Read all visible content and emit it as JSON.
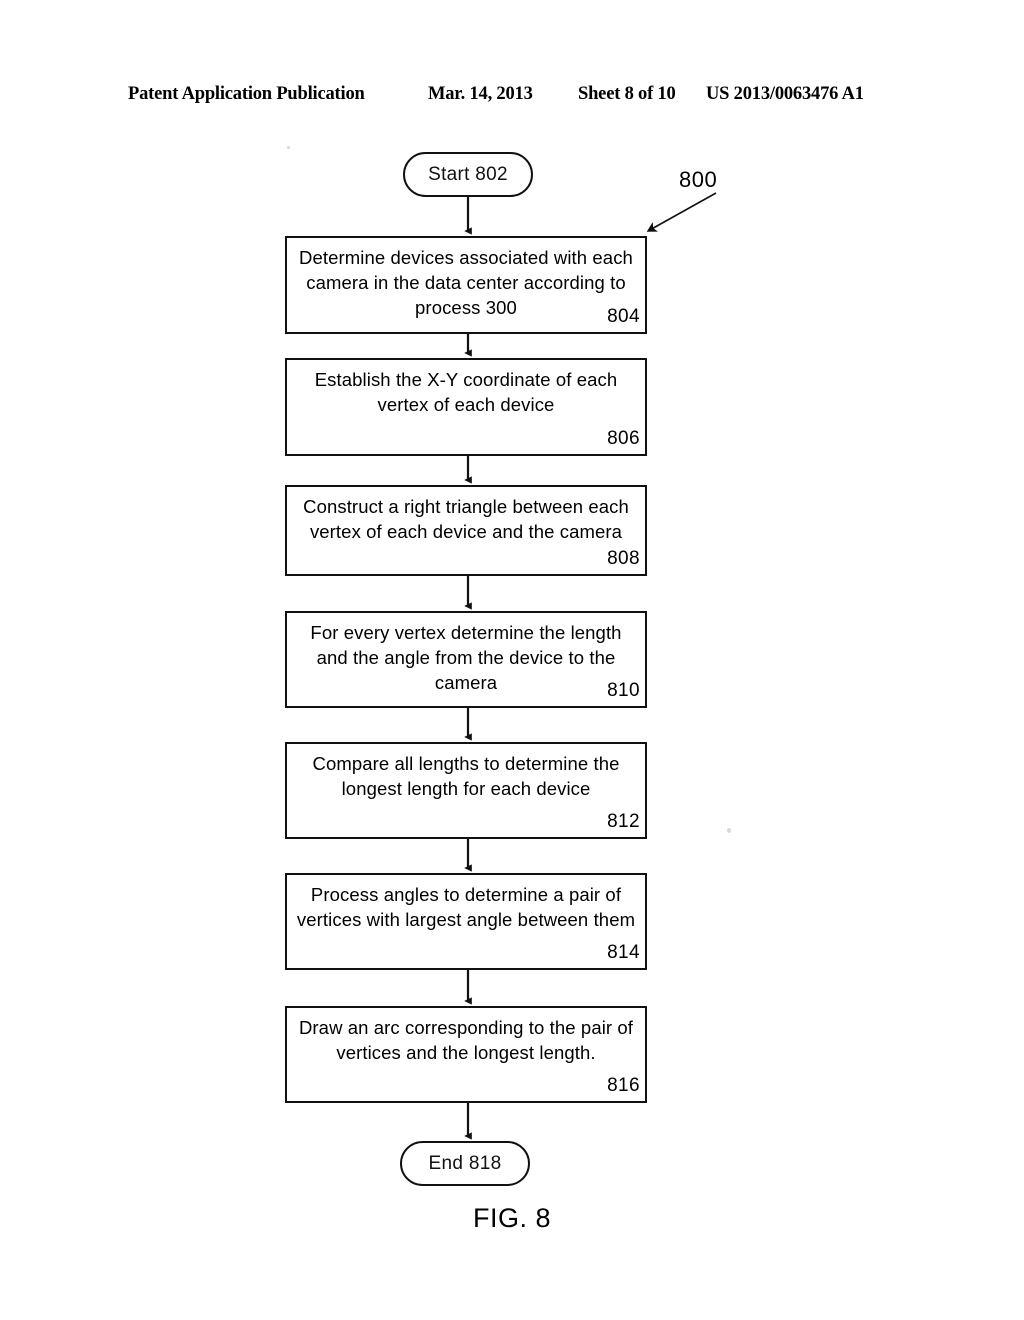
{
  "header": {
    "publication": "Patent Application Publication",
    "date": "Mar. 14, 2013",
    "sheet": "Sheet 8 of 10",
    "patent_number": "US 2013/0063476 A1"
  },
  "figure": {
    "caption": "FIG. 8",
    "diagram_ref": "800"
  },
  "flowchart": {
    "start": {
      "label": "Start 802"
    },
    "end": {
      "label": "End 818"
    },
    "steps": [
      {
        "text": "Determine devices associated with each camera in the data center according to process 300",
        "ref": "804"
      },
      {
        "text": "Establish the X-Y coordinate of each vertex of each device",
        "ref": "806"
      },
      {
        "text": "Construct a right triangle between each vertex of each device and the camera",
        "ref": "808"
      },
      {
        "text": "For every vertex determine the length and the angle from the device to the camera",
        "ref": "810"
      },
      {
        "text": "Compare all lengths to determine the longest length for each device",
        "ref": "812"
      },
      {
        "text": "Process angles to determine a pair of vertices with largest angle between them",
        "ref": "814"
      },
      {
        "text": "Draw an arc corresponding to the pair of vertices and the longest length.",
        "ref": "816"
      }
    ]
  }
}
